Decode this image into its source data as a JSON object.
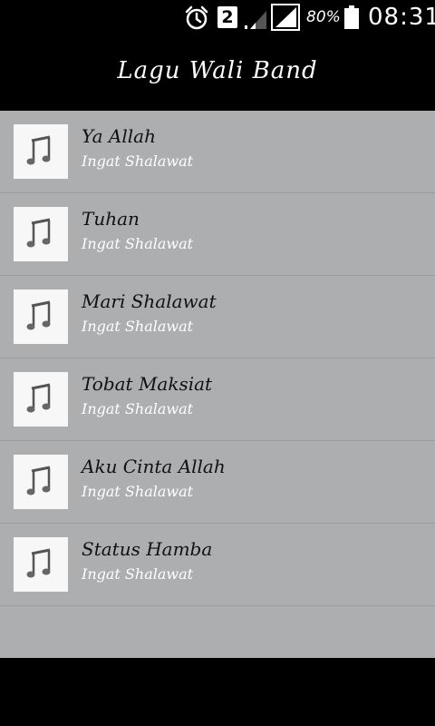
{
  "status_bar": {
    "sim_number": "2",
    "battery_percent": "80%",
    "time": "08:31",
    "icons": [
      "alarm-icon",
      "signal-icon",
      "signal-icon",
      "battery-icon"
    ]
  },
  "app": {
    "title": "Lagu Wali Band"
  },
  "colors": {
    "title_bar": "#000000",
    "list_background": "#adaeb0",
    "thumbnail_background": "#f7f7f7",
    "song_title": "#111111",
    "song_subtitle": "#ffffff"
  },
  "songs": [
    {
      "title": "Ya Allah",
      "subtitle": "Ingat Shalawat",
      "icon": "music-note-icon"
    },
    {
      "title": "Tuhan",
      "subtitle": "Ingat Shalawat",
      "icon": "music-note-icon"
    },
    {
      "title": "Mari Shalawat",
      "subtitle": "Ingat Shalawat",
      "icon": "music-note-icon"
    },
    {
      "title": "Tobat Maksiat",
      "subtitle": "Ingat Shalawat",
      "icon": "music-note-icon"
    },
    {
      "title": "Aku Cinta Allah",
      "subtitle": "Ingat Shalawat",
      "icon": "music-note-icon"
    },
    {
      "title": "Status Hamba",
      "subtitle": "Ingat Shalawat",
      "icon": "music-note-icon"
    }
  ]
}
